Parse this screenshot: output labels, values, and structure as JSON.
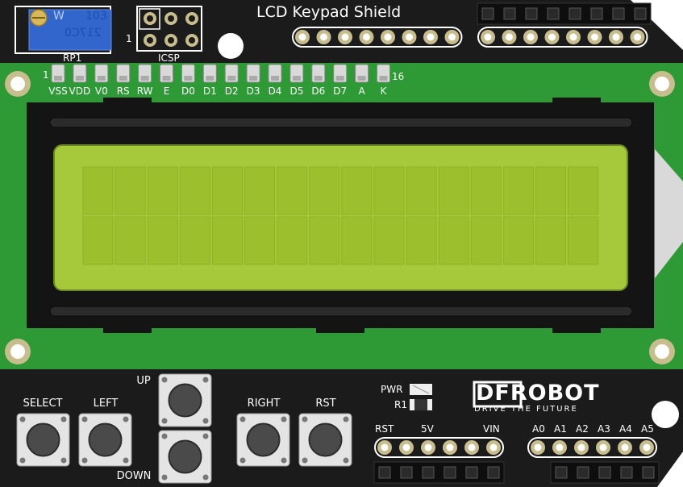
{
  "title": "LCD Keypad Shield",
  "pot": {
    "label": "RP1",
    "marking_top_left": "W",
    "marking_top_right": "103",
    "marking_bottom": "217C0"
  },
  "icsp": {
    "label": "ICSP",
    "pin1": "1"
  },
  "lcd_pins": {
    "first_index": "1",
    "last_index": "16",
    "labels": [
      "VSS",
      "VDD",
      "V0",
      "RS",
      "RW",
      "E",
      "D0",
      "D1",
      "D2",
      "D3",
      "D4",
      "D5",
      "D6",
      "D7",
      "A",
      "K"
    ]
  },
  "lcd_screen": {
    "columns": 16,
    "rows": 2
  },
  "buttons": {
    "select": "SELECT",
    "left": "LEFT",
    "up": "UP",
    "down": "DOWN",
    "right": "RIGHT",
    "rst": "RST"
  },
  "power_leds": {
    "pwr": "PWR",
    "r1": "R1"
  },
  "brand": {
    "logo_text": "DFROBOT",
    "slogan": "DRIVE THE FUTURE"
  },
  "power_header": {
    "rst": "RST",
    "v5": "5V",
    "vin": "VIN"
  },
  "analog_header": {
    "labels": [
      "A0",
      "A1",
      "A2",
      "A3",
      "A4",
      "A5"
    ]
  },
  "colors": {
    "board": "#1b1b1b",
    "pcb_green": "#2d9a36",
    "lcd_bezel": "#141414",
    "lcd_screen": "#a6c93c",
    "lcd_cell": "#9cbf2e",
    "button_body": "#e4e4e4",
    "button_cap": "#4a4a4a",
    "potentiometer": "#3366cc",
    "silk_text": "#ffffff"
  }
}
